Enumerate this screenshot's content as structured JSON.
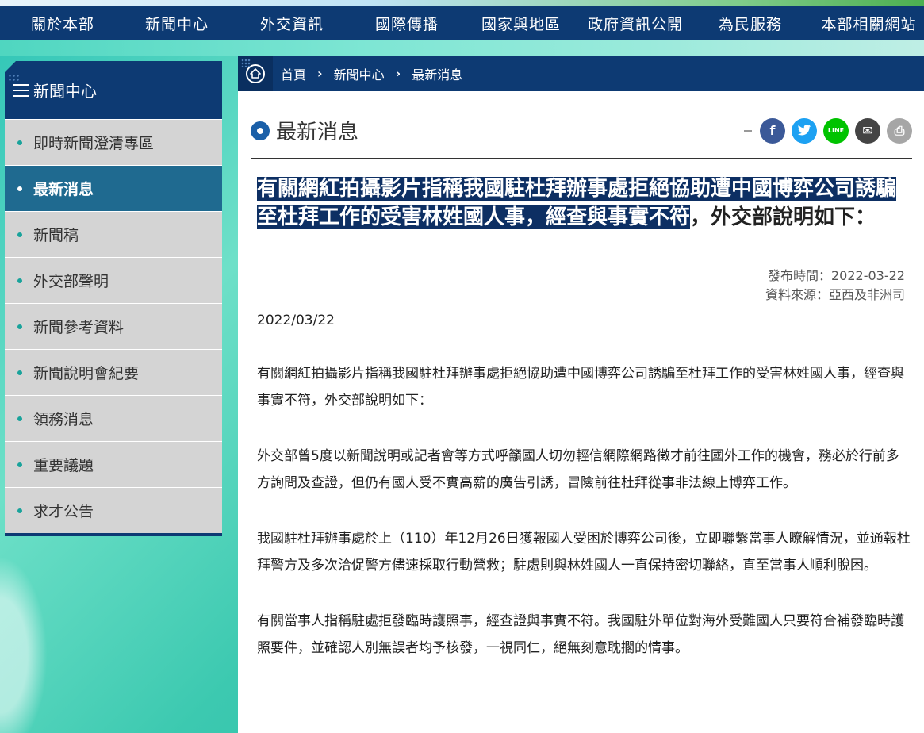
{
  "topnav": {
    "items": [
      "關於本部",
      "新聞中心",
      "外交資訊",
      "國際傳播",
      "國家與地區",
      "政府資訊公開",
      "為民服務",
      "本部相關網站"
    ]
  },
  "sidebar": {
    "title": "新聞中心",
    "items": [
      {
        "label": "即時新聞澄清專區"
      },
      {
        "label": "最新消息",
        "active": true
      },
      {
        "label": "新聞稿"
      },
      {
        "label": "外交部聲明"
      },
      {
        "label": "新聞參考資料"
      },
      {
        "label": "新聞說明會紀要"
      },
      {
        "label": "領務消息"
      },
      {
        "label": "重要議題"
      },
      {
        "label": "求才公告"
      }
    ]
  },
  "breadcrumb": {
    "home_icon": "home-icon",
    "items": [
      "首頁",
      "新聞中心",
      "最新消息"
    ],
    "separator": "›"
  },
  "page": {
    "title": "最新消息"
  },
  "share": {
    "buttons": [
      {
        "name": "facebook",
        "glyph": "f",
        "color": "#3b5998"
      },
      {
        "name": "twitter",
        "glyph": "t",
        "color": "#1da1f2"
      },
      {
        "name": "line",
        "glyph": "LINE",
        "color": "#00c300"
      },
      {
        "name": "email",
        "glyph": "✉",
        "color": "#444444"
      },
      {
        "name": "print",
        "glyph": "⎙",
        "color": "#a6a6a6"
      }
    ]
  },
  "article": {
    "title_highlight": "有關網紅拍攝影片指稱我國駐杜拜辦事處拒絕協助遭中國博弈公司誘騙至杜拜工作的受害林姓國人事，經查與事實不符",
    "title_rest": "，外交部說明如下：",
    "publish_time": "發布時間：2022-03-22",
    "source": "資料來源：亞西及非洲司",
    "date": "2022/03/22",
    "paragraphs": [
      "有關網紅拍攝影片指稱我國駐杜拜辦事處拒絕協助遭中國博弈公司誘騙至杜拜工作的受害林姓國人事，經查與事實不符，外交部說明如下：",
      "外交部曾5度以新聞說明或記者會等方式呼籲國人切勿輕信網際網路徵才前往國外工作的機會，務必於行前多方詢問及查證，但仍有國人受不實高薪的廣告引誘，冒險前往杜拜從事非法線上博弈工作。",
      "我國駐杜拜辦事處於上（110）年12月26日獲報國人受困於博弈公司後，立即聯繫當事人瞭解情況，並通報杜拜警方及多次洽促警方儘速採取行動營救；駐處則與林姓國人一直保持密切聯絡，直至當事人順利脫困。",
      "有關當事人指稱駐處拒發臨時護照事，經查證與事實不符。我國駐外單位對海外受難國人只要符合補發臨時護照要件，並確認人別無誤者均予核發，一視同仁，絕無刻意耽擱的情事。"
    ]
  }
}
